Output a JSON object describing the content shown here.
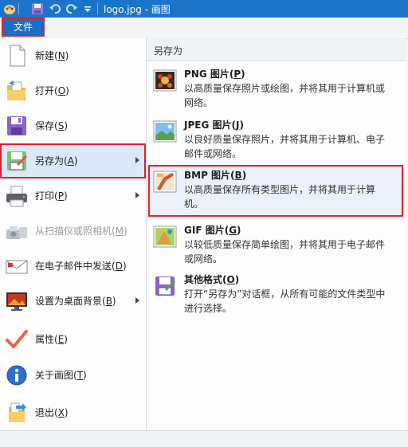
{
  "window": {
    "title": "logo.jpg - 画图",
    "quick_access": [
      "app-icon",
      "save-icon",
      "undo-icon",
      "redo-icon",
      "customize-icon"
    ]
  },
  "ribbon": {
    "file_tab_label": "文件"
  },
  "file_menu": {
    "items": [
      {
        "label": "新建(",
        "key": "N",
        "icon": "new-file-icon"
      },
      {
        "label": "打开(",
        "key": "O",
        "icon": "open-folder-icon"
      },
      {
        "label": "保存(",
        "key": "S",
        "icon": "save-icon"
      },
      {
        "label": "另存为(",
        "key": "A",
        "icon": "save-as-icon",
        "selected": true,
        "has_submenu": true
      },
      {
        "label": "打印(",
        "key": "P",
        "icon": "printer-icon",
        "has_submenu": true
      },
      {
        "label": "从扫描仪或照相机(",
        "key": "M",
        "icon": "scanner-icon",
        "disabled": true
      },
      {
        "label": "在电子邮件中发送(",
        "key": "D",
        "icon": "email-icon"
      },
      {
        "label": "设置为桌面背景(",
        "key": "B",
        "icon": "desktop-background-icon",
        "has_submenu": true
      },
      {
        "label": "属性(",
        "key": "E",
        "icon": "checkmark-icon"
      },
      {
        "label": "关于画图(",
        "key": "T",
        "icon": "info-icon"
      },
      {
        "label": "退出(",
        "key": "X",
        "icon": "exit-icon"
      }
    ]
  },
  "save_as_menu": {
    "header": "另存为",
    "options": [
      {
        "title": "PNG 图片(",
        "key": "P",
        "desc": "以高质量保存照片或绘图，并将其用于计算机或网络。",
        "icon": "png-picture-icon"
      },
      {
        "title": "JPEG 图片(",
        "key": "J",
        "desc": "以良好质量保存照片，并将其用于计算机、电子邮件或网络。",
        "icon": "jpeg-picture-icon"
      },
      {
        "title": "BMP 图片(",
        "key": "B",
        "desc": "以高质量保存所有类型图片，并将其用于计算机。",
        "icon": "bmp-picture-icon",
        "selected": true
      },
      {
        "title": "GIF 图片(",
        "key": "G",
        "desc": "以较低质量保存简单绘图，并将其用于电子邮件或网络。",
        "icon": "gif-picture-icon"
      },
      {
        "title": "其他格式(",
        "key": "O",
        "desc": "打开“另存为”对话框，从所有可能的文件类型中进行选择。",
        "icon": "other-formats-icon"
      }
    ]
  },
  "colors": {
    "titlebar": "#1a74c9",
    "highlight_border": "#e0202a",
    "selected_bg": "#dbe8f7"
  }
}
